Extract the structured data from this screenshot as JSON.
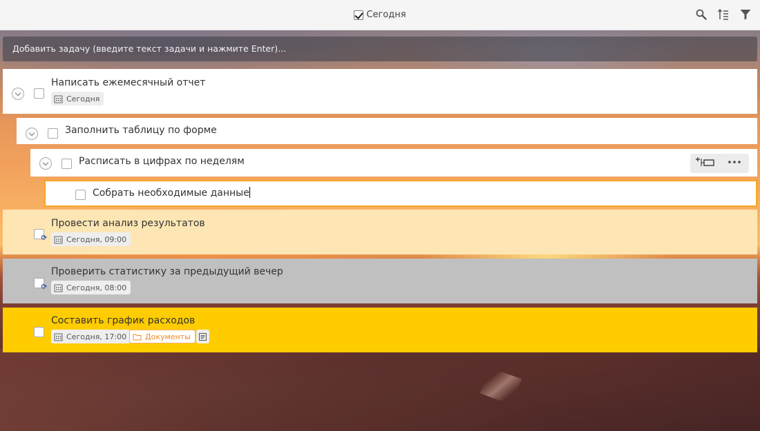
{
  "topbar": {
    "filter_label": "Сегодня",
    "tools": [
      "search-icon",
      "sort-icon",
      "filter-icon"
    ]
  },
  "add_task": {
    "placeholder": "Добавить задачу (введите текст задачи и нажмите Enter)..."
  },
  "tasks": [
    {
      "title": "Написать ежемесячный отчет",
      "date": "Сегодня",
      "bg": "#ffffff"
    },
    {
      "title": "Заполнить таблицу по форме",
      "bg": "#ffffff"
    },
    {
      "title": "Расписать в цифрах по неделям",
      "bg": "#ffffff",
      "actions": [
        "add-subtask-icon",
        "more-icon"
      ]
    },
    {
      "title": "Собрать необходимые данные",
      "bg": "#ffffff",
      "border": "#f5a623"
    },
    {
      "title": "Провести анализ результатов",
      "date": "Сегодня, 09:00",
      "bg": "#fde6b3",
      "repeat": true
    },
    {
      "title": "Проверить статистику за предыдущий вечер",
      "date": "Сегодня, 08:00",
      "bg": "#c0c0c0",
      "repeat": true
    },
    {
      "title": "Составить график расходов",
      "date": "Сегодня, 17:00",
      "folder": "Документы",
      "bg": "#ffcc00",
      "note": true
    }
  ]
}
